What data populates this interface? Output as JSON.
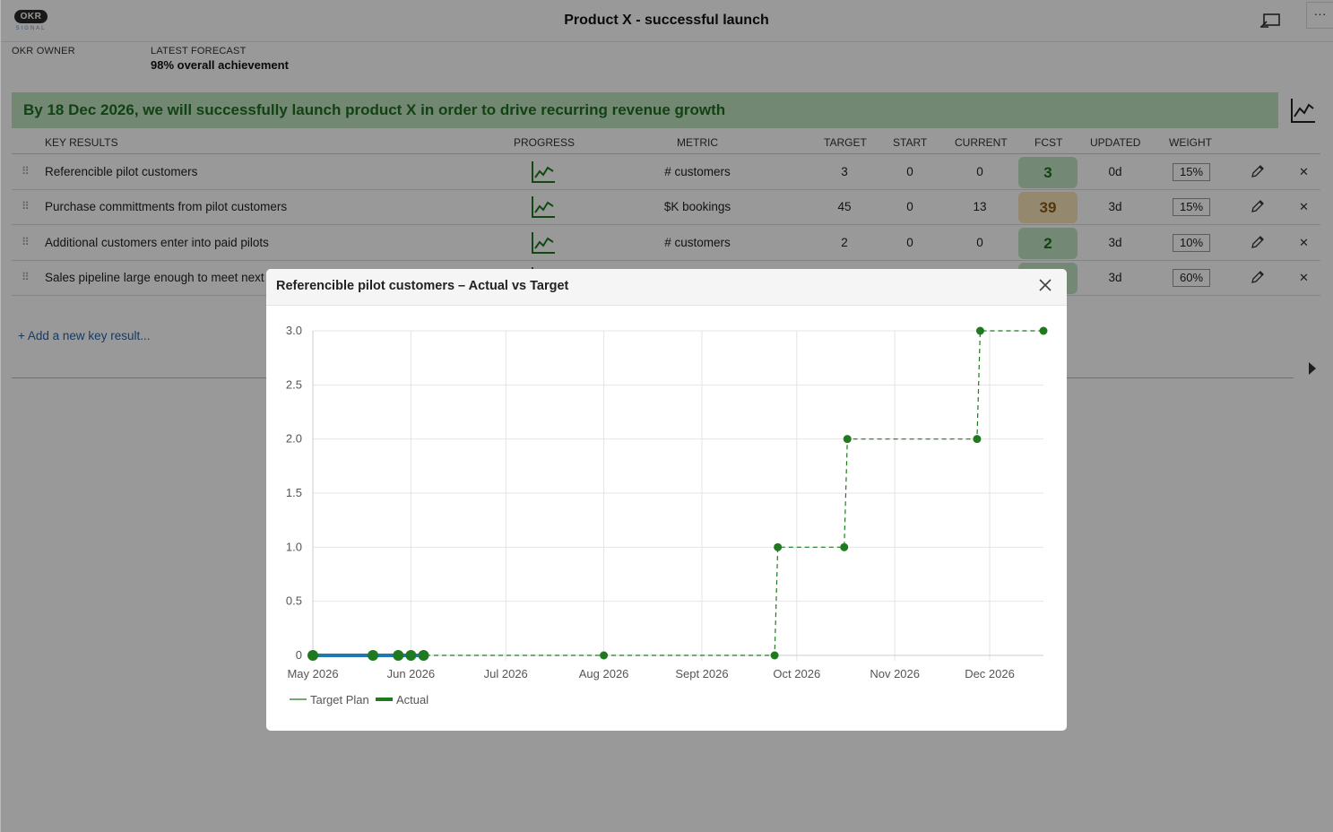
{
  "header": {
    "logo_text": "OKR",
    "logo_sub": "SIGNAL",
    "title": "Product X - successful launch",
    "more_label": "···"
  },
  "meta": {
    "owner_label": "OKR OWNER",
    "owner_value": "",
    "forecast_label": "LATEST FORECAST",
    "forecast_value": "98% overall achievement"
  },
  "objective": {
    "text": "By 18 Dec 2026, we will successfully launch product X in order to drive recurring revenue growth"
  },
  "table": {
    "headers": {
      "key_results": "KEY RESULTS",
      "progress": "PROGRESS",
      "metric": "METRIC",
      "target": "TARGET",
      "start": "START",
      "current": "CURRENT",
      "fcst": "FCST",
      "updated": "UPDATED",
      "weight": "WEIGHT"
    },
    "rows": [
      {
        "name": "Referencible pilot customers",
        "metric": "# customers",
        "target": "3",
        "start": "0",
        "current": "0",
        "fcst": "3",
        "fcst_status": "good",
        "updated": "0d",
        "weight": "15%"
      },
      {
        "name": "Purchase committments from pilot customers",
        "metric": "$K bookings",
        "target": "45",
        "start": "0",
        "current": "13",
        "fcst": "39",
        "fcst_status": "warning",
        "updated": "3d",
        "weight": "15%"
      },
      {
        "name": "Additional customers enter into paid pilots",
        "metric": "# customers",
        "target": "2",
        "start": "0",
        "current": "0",
        "fcst": "2",
        "fcst_status": "good",
        "updated": "3d",
        "weight": "10%"
      },
      {
        "name": "Sales pipeline large enough to meet next y",
        "metric": "",
        "target": "",
        "start": "",
        "current": "",
        "fcst": "",
        "fcst_status": "good",
        "updated": "3d",
        "weight": "60%"
      }
    ],
    "add_label": "+ Add a new key result..."
  },
  "colors": {
    "objective_bg": "#bfe3c0",
    "objective_text": "#1e6f20",
    "fcst_good_bg": "#c2e4c4",
    "fcst_good_text": "#1e6f20",
    "fcst_warning_bg": "#f7e3b8",
    "fcst_warning_text": "#8a5a10",
    "target_line": "#1f7a1f",
    "actual_line": "#1f78b4"
  },
  "modal": {
    "title": "Referencible pilot customers – Actual vs Target",
    "close_icon": "close-icon"
  },
  "chart_data": {
    "type": "line",
    "x_axis": "date",
    "xlim": [
      "2026-05-01",
      "2026-12-18"
    ],
    "ylim": [
      0,
      3
    ],
    "x_ticks": [
      {
        "date": "2026-05-01",
        "label": "May 2026"
      },
      {
        "date": "2026-06-01",
        "label": "Jun 2026"
      },
      {
        "date": "2026-07-01",
        "label": "Jul 2026"
      },
      {
        "date": "2026-08-01",
        "label": "Aug 2026"
      },
      {
        "date": "2026-09-01",
        "label": "Sept 2026"
      },
      {
        "date": "2026-10-01",
        "label": "Oct 2026"
      },
      {
        "date": "2026-11-01",
        "label": "Nov 2026"
      },
      {
        "date": "2026-12-01",
        "label": "Dec 2026"
      }
    ],
    "y_ticks": [
      {
        "value": 0,
        "label": "0"
      },
      {
        "value": 0.5,
        "label": "0.5"
      },
      {
        "value": 1,
        "label": "1.0"
      },
      {
        "value": 1.5,
        "label": "1.5"
      },
      {
        "value": 2,
        "label": "2.0"
      },
      {
        "value": 2.5,
        "label": "2.5"
      },
      {
        "value": 3,
        "label": "3.0"
      }
    ],
    "grid": true,
    "legend_position": "bottom-left",
    "series": [
      {
        "name": "Target Plan",
        "style": "dashed-step",
        "points": [
          {
            "x": "2026-05-01",
            "y": 0
          },
          {
            "x": "2026-05-20",
            "y": 0
          },
          {
            "x": "2026-05-28",
            "y": 0
          },
          {
            "x": "2026-06-01",
            "y": 0
          },
          {
            "x": "2026-06-05",
            "y": 0
          },
          {
            "x": "2026-08-01",
            "y": 0
          },
          {
            "x": "2026-09-24",
            "y": 0
          },
          {
            "x": "2026-09-25",
            "y": 1
          },
          {
            "x": "2026-10-16",
            "y": 1
          },
          {
            "x": "2026-10-17",
            "y": 2
          },
          {
            "x": "2026-11-27",
            "y": 2
          },
          {
            "x": "2026-11-28",
            "y": 3
          },
          {
            "x": "2026-12-18",
            "y": 3
          }
        ]
      },
      {
        "name": "Actual",
        "style": "solid",
        "points": [
          {
            "x": "2026-05-01",
            "y": 0
          },
          {
            "x": "2026-05-20",
            "y": 0
          },
          {
            "x": "2026-05-28",
            "y": 0
          },
          {
            "x": "2026-06-01",
            "y": 0
          },
          {
            "x": "2026-06-05",
            "y": 0
          }
        ]
      }
    ]
  }
}
